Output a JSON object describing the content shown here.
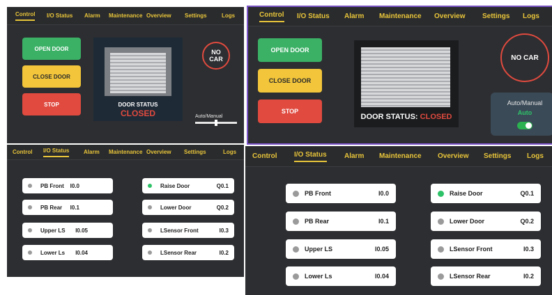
{
  "tabs": [
    "Control",
    "I/O Status",
    "Alarm",
    "Maintenance",
    "Overview",
    "Settings",
    "Logs"
  ],
  "control": {
    "open_label": "OPEN DOOR",
    "close_label": "CLOSE DOOR",
    "stop_label": "STOP",
    "door_status_caption": "DOOR STATUS",
    "door_status_prefix": "DOOR STATUS: ",
    "door_status_value": "CLOSED",
    "car_indicator": "NO CAR",
    "mode_label": "Auto/Manual",
    "mode_value": "Auto"
  },
  "io_status": {
    "inputs": [
      {
        "name": "PB Front",
        "addr": "I0.0",
        "active": false
      },
      {
        "name": "PB Rear",
        "addr": "I0.1",
        "active": false
      },
      {
        "name": "Upper LS",
        "addr": "I0.05",
        "active": false
      },
      {
        "name": "Lower Ls",
        "addr": "I0.04",
        "active": false
      }
    ],
    "outputs": [
      {
        "name": "Raise Door",
        "addr": "Q0.1",
        "active": true
      },
      {
        "name": "Lower Door",
        "addr": "Q0.2",
        "active": false
      },
      {
        "name": "LSensor Front",
        "addr": "I0.3",
        "active": false
      },
      {
        "name": "LSensor Rear",
        "addr": "I0.2",
        "active": false
      }
    ]
  },
  "colors": {
    "accent": "#e8c53a",
    "green": "#3bb166",
    "yellow": "#f2c53a",
    "red": "#e04a3f",
    "active_led": "#2ec268",
    "inactive_led": "#9a9a9a"
  }
}
